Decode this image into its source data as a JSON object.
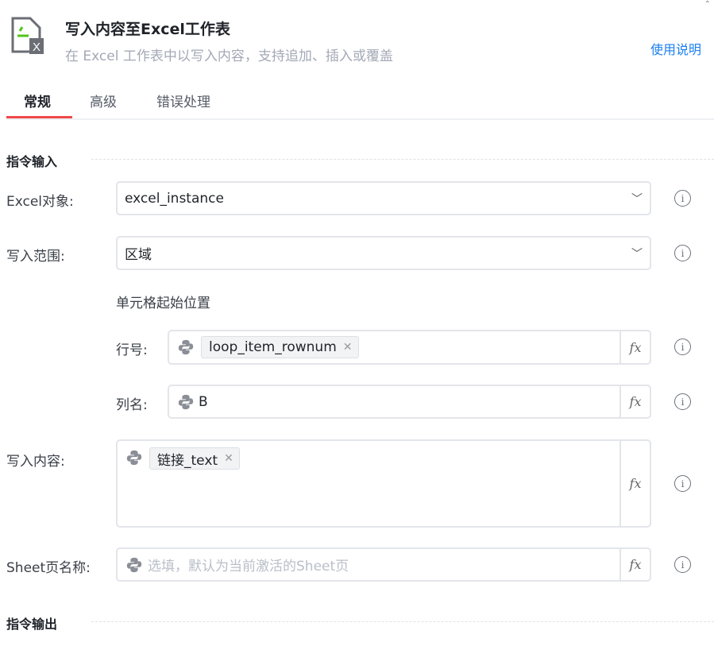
{
  "header": {
    "title": "写入内容至Excel工作表",
    "subtitle": "在 Excel 工作表中以写入内容，支持追加、插入或覆盖",
    "help": "使用说明",
    "icon": "excel-file-icon"
  },
  "tabs": [
    {
      "label": "常规",
      "active": true
    },
    {
      "label": "高级"
    },
    {
      "label": "错误处理"
    }
  ],
  "sections": {
    "input": "指令输入",
    "output": "指令输出"
  },
  "fields": {
    "excel_object": {
      "label": "Excel对象:",
      "value": "excel_instance"
    },
    "range": {
      "label": "写入范围:",
      "value": "区域"
    },
    "cell_start": "单元格起始位置",
    "row": {
      "label": "行号:",
      "tag": "loop_item_rownum"
    },
    "col": {
      "label": "列名:",
      "value": "B"
    },
    "content": {
      "label": "写入内容:",
      "tag": "链接_text"
    },
    "sheet": {
      "label": "Sheet页名称:",
      "placeholder": "选填，默认为当前激活的Sheet页"
    }
  },
  "fx_label": "fx",
  "colors": {
    "accent": "#f0484a",
    "link": "#1a7ff0"
  }
}
